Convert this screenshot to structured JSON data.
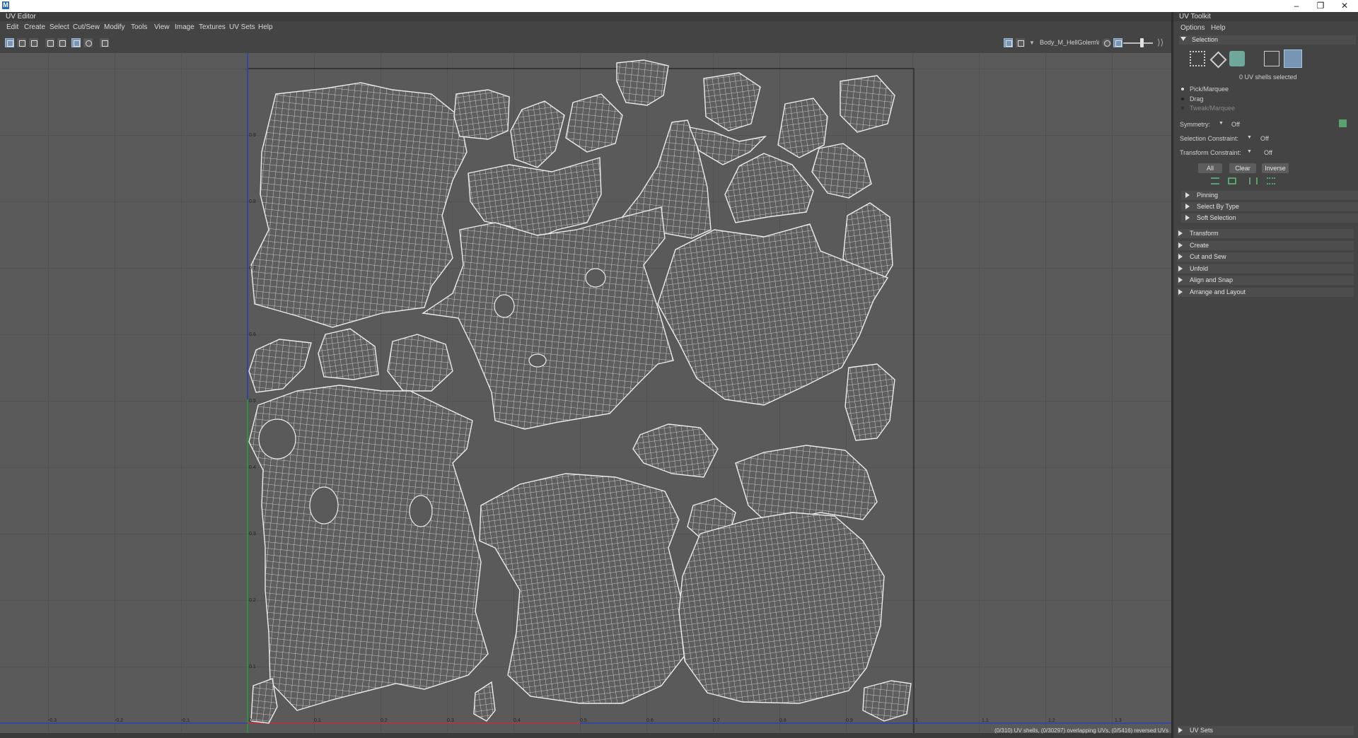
{
  "os": {
    "controls": [
      "–",
      "❐",
      "✕"
    ]
  },
  "editor": {
    "title": "UV Editor",
    "menu": [
      "Edit",
      "Create",
      "Select",
      "Cut/Sew",
      "Modify",
      "Tools",
      "View",
      "Image",
      "Textures",
      "UV Sets",
      "Help"
    ],
    "texture_name": "Body_M_HellGolemWi",
    "axis_ticks_u": [
      "-0.3",
      "-0.2",
      "-0.1",
      "0",
      "0.1",
      "0.2",
      "0.3",
      "0.4",
      "0.5",
      "0.6",
      "0.7",
      "0.8",
      "0.9",
      "1",
      "1.1",
      "1.2",
      "1.3"
    ],
    "axis_ticks_v": [
      "0.9",
      "0.8",
      "0.7",
      "0.6",
      "0.5",
      "0.4",
      "0.3",
      "0.2",
      "0.1"
    ],
    "status": "(0/310) UV shells, (0/30297) overlapping UVs, (0/5416) reversed UVs"
  },
  "toolkit": {
    "title": "UV Toolkit",
    "menu": [
      "Options",
      "Help"
    ],
    "selection_header": "Selection",
    "selected_count": "0 UV shells selected",
    "modes": [
      "Pick/Marquee",
      "Drag",
      "Tweak/Marquee"
    ],
    "symmetry_label": "Symmetry:",
    "symmetry_value": "Off",
    "selection_constraint_label": "Selection Constraint:",
    "selection_constraint_value": "Off",
    "transform_constraint_label": "Transform Constraint:",
    "transform_constraint_value": "Off",
    "buttons": {
      "all": "All",
      "clear": "Clear",
      "inverse": "Inverse"
    },
    "subsections": [
      "Pinning",
      "Select By Type",
      "Soft Selection"
    ],
    "sections": [
      "Transform",
      "Create",
      "Cut and Sew",
      "Unfold",
      "Align and Snap",
      "Arrange and Layout"
    ],
    "footer_section": "UV Sets"
  },
  "colors": {
    "accent": "#7896b4",
    "u_axis": "#c83232",
    "v_axis": "#32a032"
  }
}
